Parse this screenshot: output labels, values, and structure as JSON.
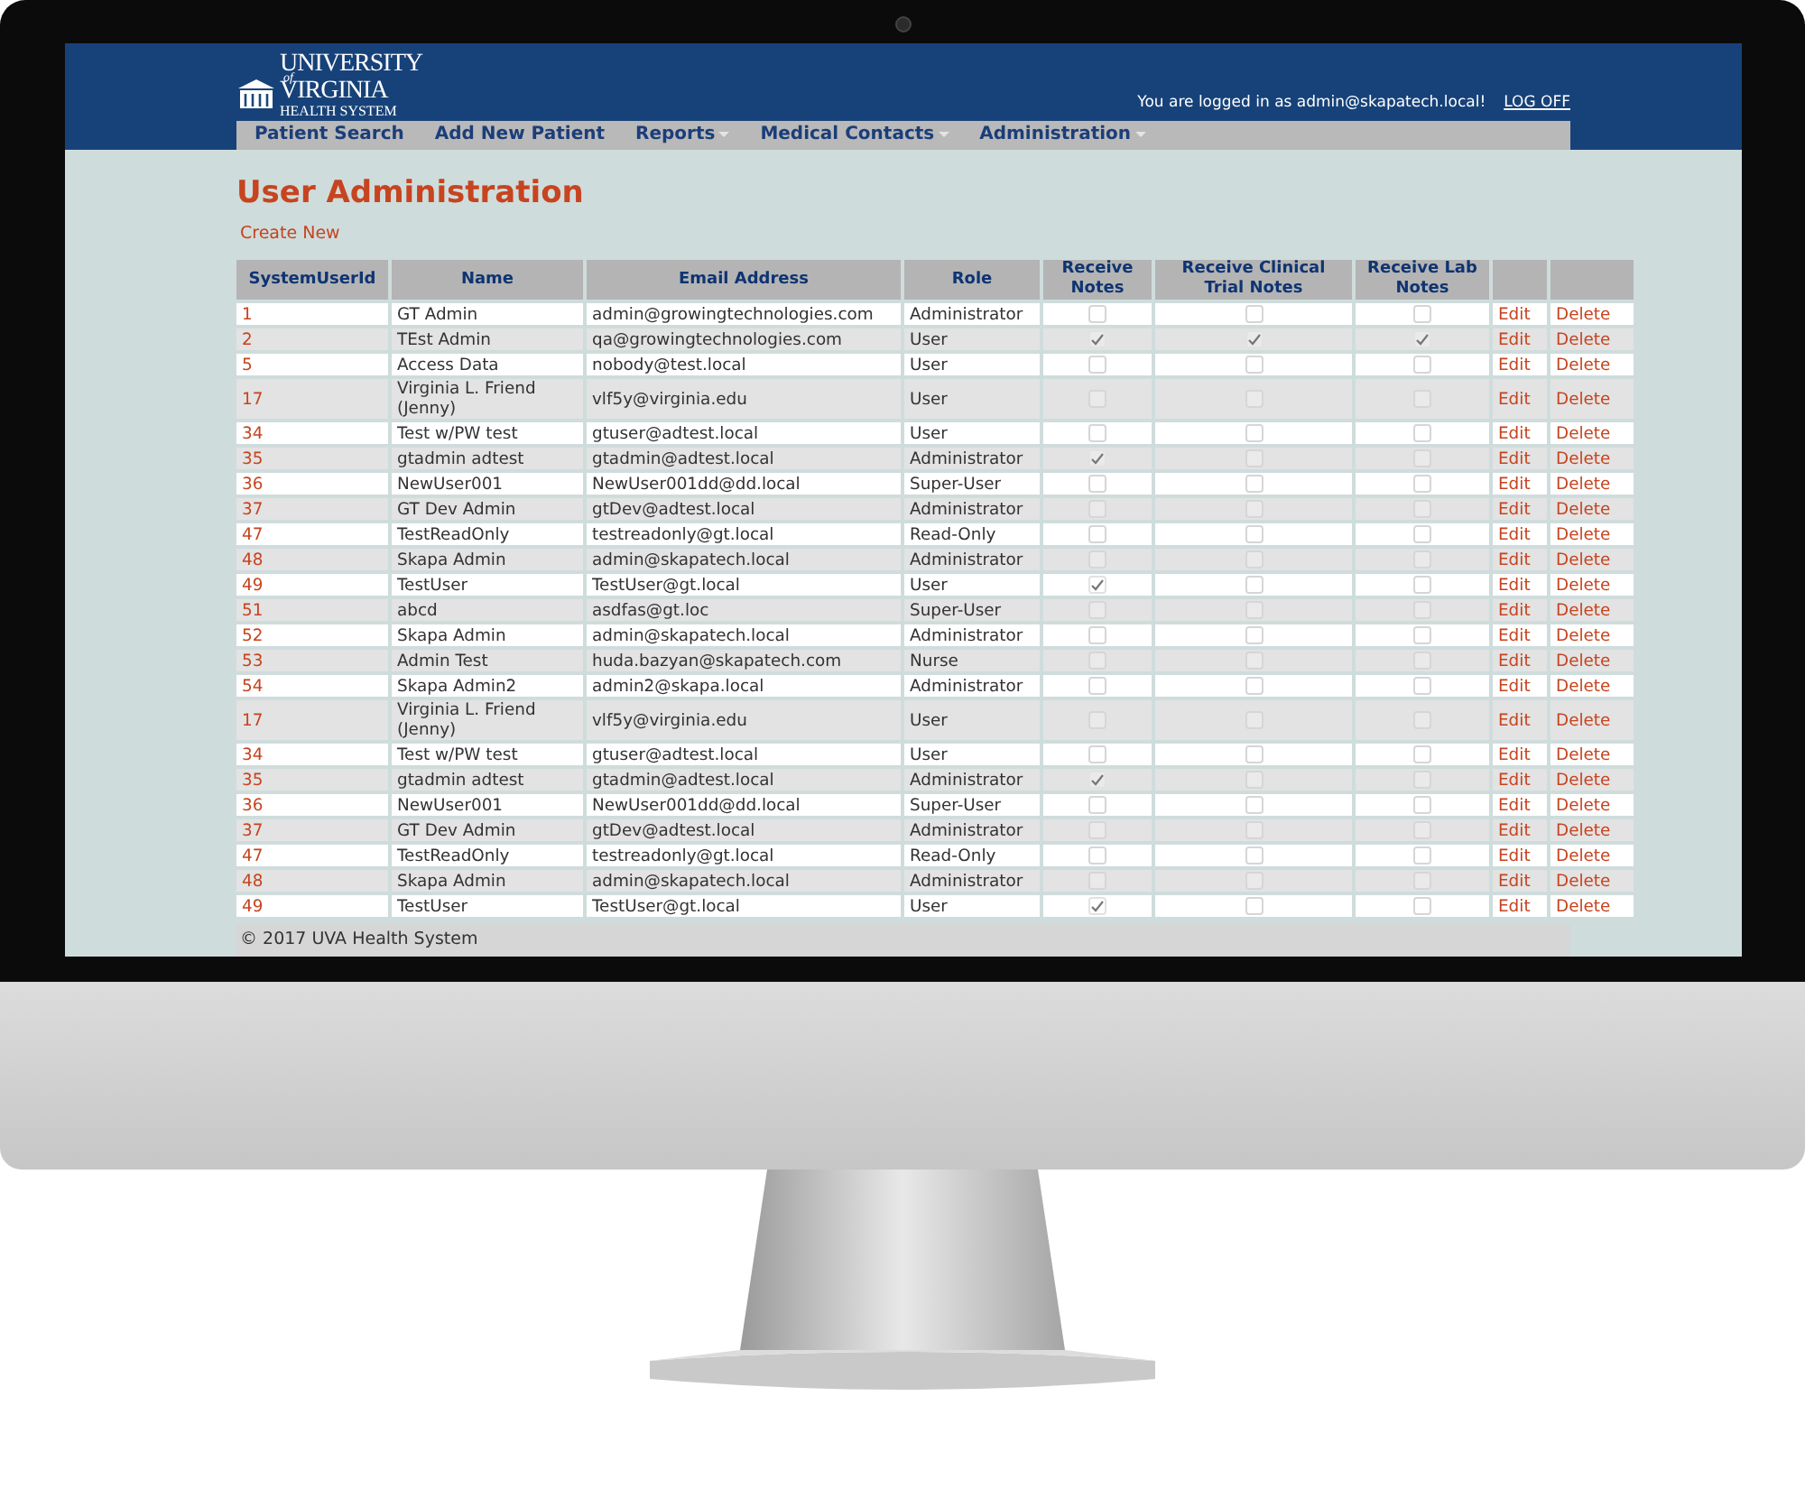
{
  "logo": {
    "lines": [
      "UNIVERSITY",
      "of",
      "VIRGINIA",
      "HEALTH SYSTEM"
    ]
  },
  "login": {
    "text": "You are logged in as admin@skapatech.local!",
    "logoff": "LOG OFF"
  },
  "nav": [
    {
      "label": "Patient Search",
      "has_menu": false
    },
    {
      "label": "Add New Patient",
      "has_menu": false
    },
    {
      "label": "Reports",
      "has_menu": true
    },
    {
      "label": "Medical Contacts",
      "has_menu": true
    },
    {
      "label": "Administration",
      "has_menu": true
    }
  ],
  "title": "User Administration",
  "create_new": "Create New",
  "table": {
    "columns": [
      "SystemUserId",
      "Name",
      "Email Address",
      "Role",
      "Receive Notes",
      "Receive Clinical Trial Notes",
      "Receive Lab Notes"
    ],
    "rows": [
      {
        "id": "1",
        "name": "GT Admin",
        "email": "admin@growingtechnologies.com",
        "role": "Administrator",
        "notes": false,
        "clinical": false,
        "lab": false,
        "edit": "Edit",
        "delete": "Delete"
      },
      {
        "id": "2",
        "name": "TEst Admin",
        "email": "qa@growingtechnologies.com",
        "role": "User",
        "notes": true,
        "clinical": true,
        "lab": true,
        "edit": "Edit",
        "delete": "Delete"
      },
      {
        "id": "5",
        "name": "Access Data",
        "email": "nobody@test.local",
        "role": "User",
        "notes": false,
        "clinical": false,
        "lab": false,
        "edit": "Edit",
        "delete": "Delete"
      },
      {
        "id": "17",
        "name": "Virginia L. Friend (Jenny)",
        "email": "vlf5y@virginia.edu",
        "role": "User",
        "notes": false,
        "clinical": false,
        "lab": false,
        "edit": "Edit",
        "delete": "Delete"
      },
      {
        "id": "34",
        "name": "Test w/PW test",
        "email": "gtuser@adtest.local",
        "role": "User",
        "notes": false,
        "clinical": false,
        "lab": false,
        "edit": "Edit",
        "delete": "Delete"
      },
      {
        "id": "35",
        "name": "gtadmin adtest",
        "email": "gtadmin@adtest.local",
        "role": "Administrator",
        "notes": true,
        "clinical": false,
        "lab": false,
        "edit": "Edit",
        "delete": "Delete"
      },
      {
        "id": "36",
        "name": "NewUser001",
        "email": "NewUser001dd@dd.local",
        "role": "Super-User",
        "notes": false,
        "clinical": false,
        "lab": false,
        "edit": "Edit",
        "delete": "Delete"
      },
      {
        "id": "37",
        "name": "GT Dev Admin",
        "email": "gtDev@adtest.local",
        "role": "Administrator",
        "notes": false,
        "clinical": false,
        "lab": false,
        "edit": "Edit",
        "delete": "Delete"
      },
      {
        "id": "47",
        "name": "TestReadOnly",
        "email": "testreadonly@gt.local",
        "role": "Read-Only",
        "notes": false,
        "clinical": false,
        "lab": false,
        "edit": "Edit",
        "delete": "Delete"
      },
      {
        "id": "48",
        "name": "Skapa Admin",
        "email": "admin@skapatech.local",
        "role": "Administrator",
        "notes": false,
        "clinical": false,
        "lab": false,
        "edit": "Edit",
        "delete": "Delete"
      },
      {
        "id": "49",
        "name": "TestUser",
        "email": "TestUser@gt.local",
        "role": "User",
        "notes": true,
        "clinical": false,
        "lab": false,
        "edit": "Edit",
        "delete": "Delete"
      },
      {
        "id": "51",
        "name": "abcd",
        "email": "asdfas@gt.loc",
        "role": "Super-User",
        "notes": false,
        "clinical": false,
        "lab": false,
        "edit": "Edit",
        "delete": "Delete"
      },
      {
        "id": "52",
        "name": "Skapa Admin",
        "email": "admin@skapatech.local",
        "role": "Administrator",
        "notes": false,
        "clinical": false,
        "lab": false,
        "edit": "Edit",
        "delete": "Delete"
      },
      {
        "id": "53",
        "name": "Admin Test",
        "email": "huda.bazyan@skapatech.com",
        "role": "Nurse",
        "notes": false,
        "clinical": false,
        "lab": false,
        "edit": "Edit",
        "delete": "Delete"
      },
      {
        "id": "54",
        "name": "Skapa Admin2",
        "email": "admin2@skapa.local",
        "role": "Administrator",
        "notes": false,
        "clinical": false,
        "lab": false,
        "edit": "Edit",
        "delete": "Delete"
      },
      {
        "id": "17",
        "name": "Virginia L. Friend (Jenny)",
        "email": "vlf5y@virginia.edu",
        "role": "User",
        "notes": false,
        "clinical": false,
        "lab": false,
        "edit": "Edit",
        "delete": "Delete"
      },
      {
        "id": "34",
        "name": "Test w/PW test",
        "email": "gtuser@adtest.local",
        "role": "User",
        "notes": false,
        "clinical": false,
        "lab": false,
        "edit": "Edit",
        "delete": "Delete"
      },
      {
        "id": "35",
        "name": "gtadmin adtest",
        "email": "gtadmin@adtest.local",
        "role": "Administrator",
        "notes": true,
        "clinical": false,
        "lab": false,
        "edit": "Edit",
        "delete": "Delete"
      },
      {
        "id": "36",
        "name": "NewUser001",
        "email": "NewUser001dd@dd.local",
        "role": "Super-User",
        "notes": false,
        "clinical": false,
        "lab": false,
        "edit": "Edit",
        "delete": "Delete"
      },
      {
        "id": "37",
        "name": "GT Dev Admin",
        "email": "gtDev@adtest.local",
        "role": "Administrator",
        "notes": false,
        "clinical": false,
        "lab": false,
        "edit": "Edit",
        "delete": "Delete"
      },
      {
        "id": "47",
        "name": "TestReadOnly",
        "email": "testreadonly@gt.local",
        "role": "Read-Only",
        "notes": false,
        "clinical": false,
        "lab": false,
        "edit": "Edit",
        "delete": "Delete"
      },
      {
        "id": "48",
        "name": "Skapa Admin",
        "email": "admin@skapatech.local",
        "role": "Administrator",
        "notes": false,
        "clinical": false,
        "lab": false,
        "edit": "Edit",
        "delete": "Delete"
      },
      {
        "id": "49",
        "name": "TestUser",
        "email": "TestUser@gt.local",
        "role": "User",
        "notes": true,
        "clinical": false,
        "lab": false,
        "edit": "Edit",
        "delete": "Delete"
      }
    ]
  },
  "footer": "© 2017 UVA Health System"
}
